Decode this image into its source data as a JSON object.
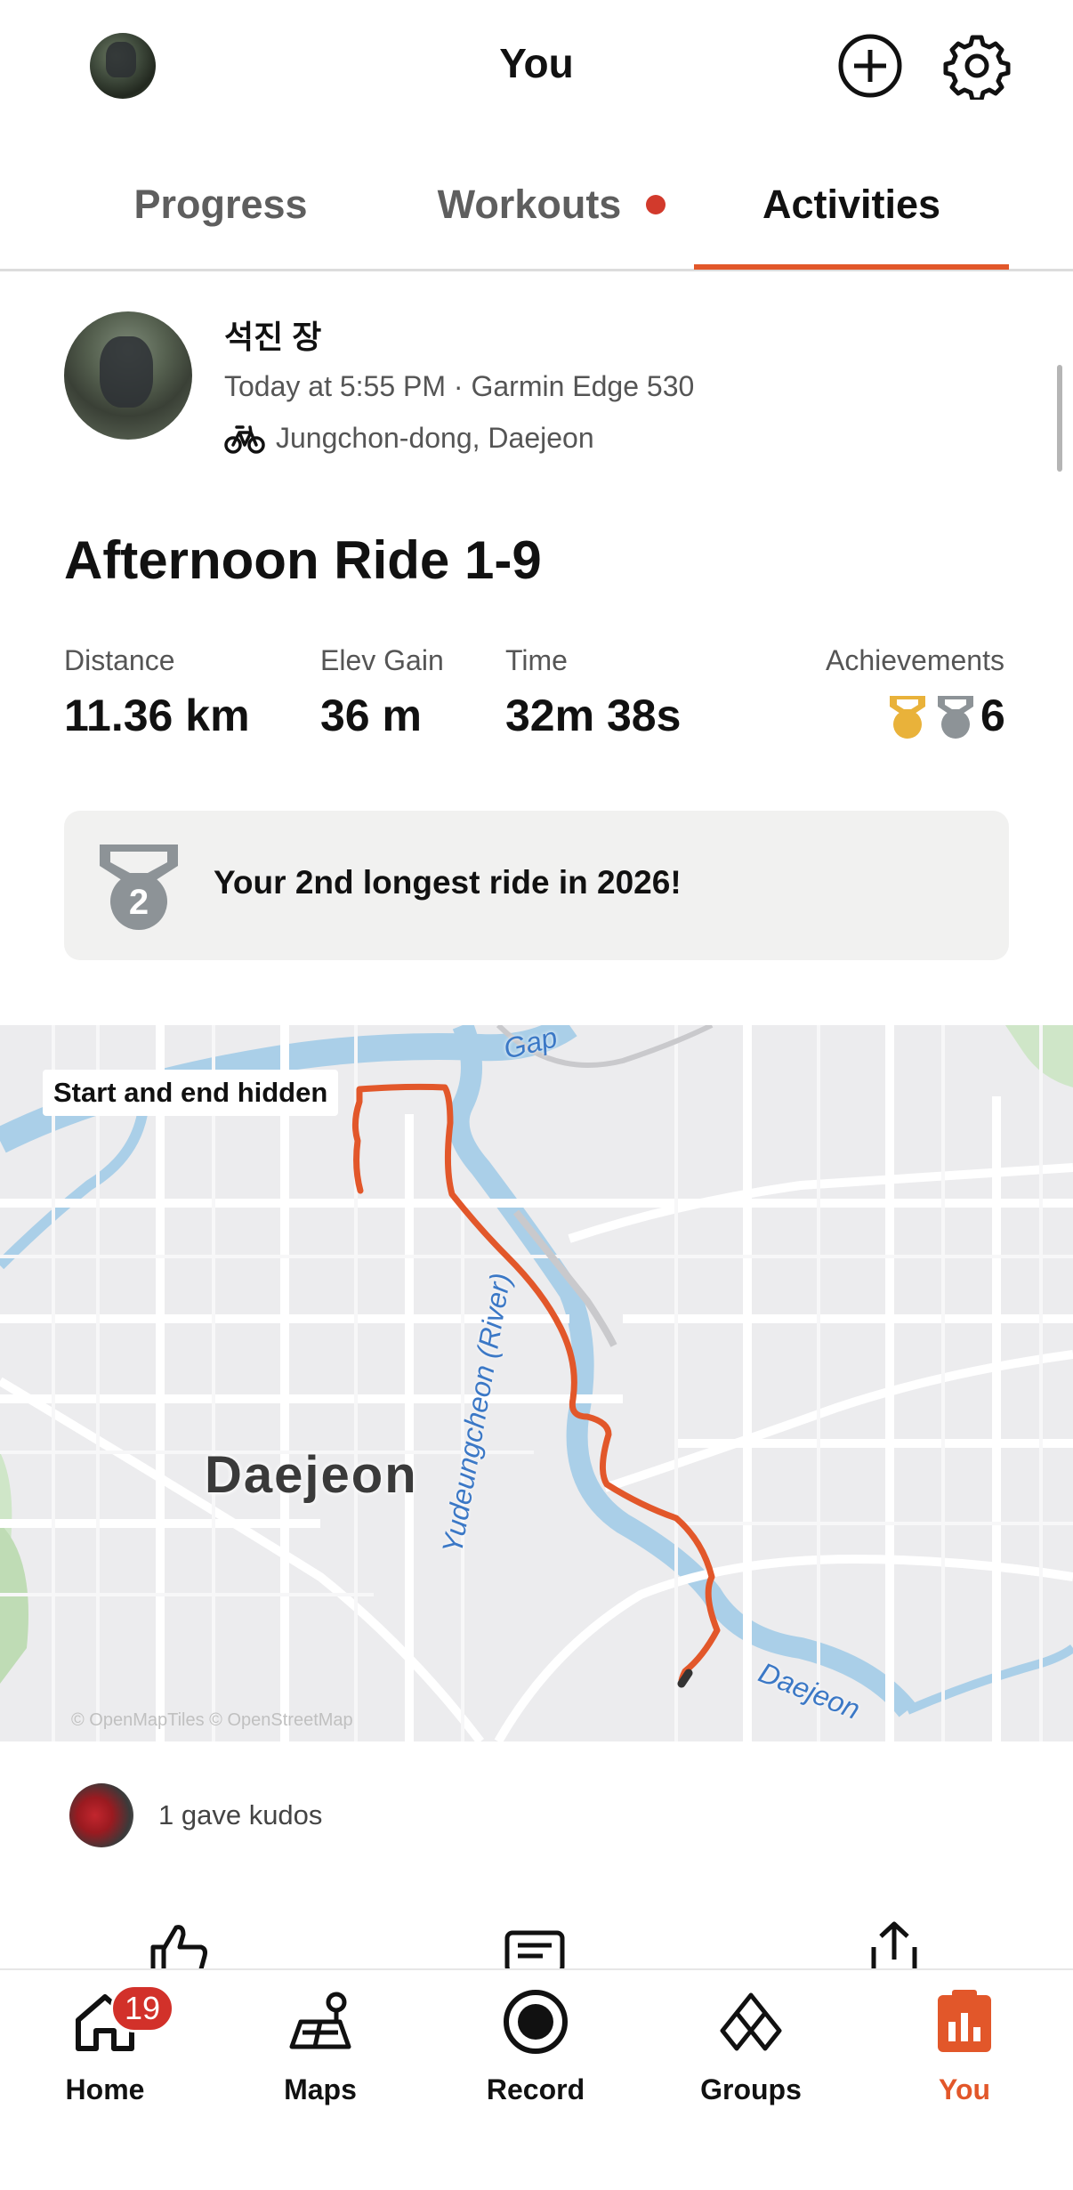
{
  "header": {
    "title": "You"
  },
  "tabs": [
    {
      "label": "Progress",
      "active": false
    },
    {
      "label": "Workouts",
      "active": false,
      "notification_dot": true
    },
    {
      "label": "Activities",
      "active": true
    }
  ],
  "activity": {
    "athlete_name": "석진 장",
    "meta": "Today at 5:55 PM · Garmin Edge 530",
    "sport_icon": "bike-icon",
    "location": "Jungchon-dong, Daejeon",
    "title": "Afternoon Ride 1-9",
    "stats": [
      {
        "label": "Distance",
        "value": "11.36 km"
      },
      {
        "label": "Elev Gain",
        "value": "36 m"
      },
      {
        "label": "Time",
        "value": "32m 38s"
      },
      {
        "label": "Achievements",
        "value": "6"
      }
    ],
    "highlight": {
      "medal_number": "2",
      "text": "Your 2nd longest ride in 2026!"
    }
  },
  "map": {
    "privacy_label": "Start and end hidden",
    "city": "Daejeon",
    "rivers": [
      "Gap",
      "Yudeungcheon (River)",
      "Daejeon"
    ],
    "attribution": "© OpenMapTiles © OpenStreetMap",
    "route_color": "#e2572a"
  },
  "kudos": {
    "text": "1 gave kudos"
  },
  "nav": [
    {
      "label": "Home",
      "badge": "19",
      "active": false
    },
    {
      "label": "Maps",
      "active": false
    },
    {
      "label": "Record",
      "active": false
    },
    {
      "label": "Groups",
      "active": false
    },
    {
      "label": "You",
      "active": true
    }
  ],
  "colors": {
    "accent": "#e2572a",
    "badge": "#d2312a",
    "gold": "#e9b23a",
    "silver": "#8d9397"
  }
}
